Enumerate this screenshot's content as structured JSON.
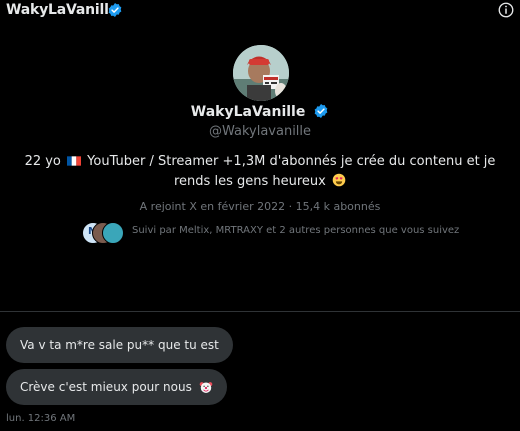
{
  "header": {
    "name": "WakyLaVanille"
  },
  "profile": {
    "name": "WakyLaVanille",
    "handle": "@Wakylavanille",
    "bio_before_flag": "22 yo",
    "bio_after_flag": "YouTuber / Streamer +1,3M d'abonnés je crée du contenu et je rends les gens heureux",
    "meta": "A rejoint X en février 2022 · 15,4 k abonnés",
    "followed_by": "Suivi par Meltix, MRTRAXY et 2 autres personnes que vous suivez"
  },
  "messages": [
    {
      "text": "Va v ta m*re sale pu** que tu est"
    },
    {
      "text": "Crève c'est mieux pour nous"
    }
  ],
  "timestamp": "lun. 12:36 AM",
  "icons": {
    "verified": "verified-badge-icon",
    "info": "info-icon",
    "flag": "france-flag-icon",
    "heart_eyes": "heart-eyes-emoji-icon",
    "clown": "clown-emoji-icon"
  },
  "colors": {
    "background": "#000000",
    "text": "#e7e9ea",
    "muted": "#71767b",
    "bubble": "#2f3336",
    "verified": "#1d9bf0"
  }
}
